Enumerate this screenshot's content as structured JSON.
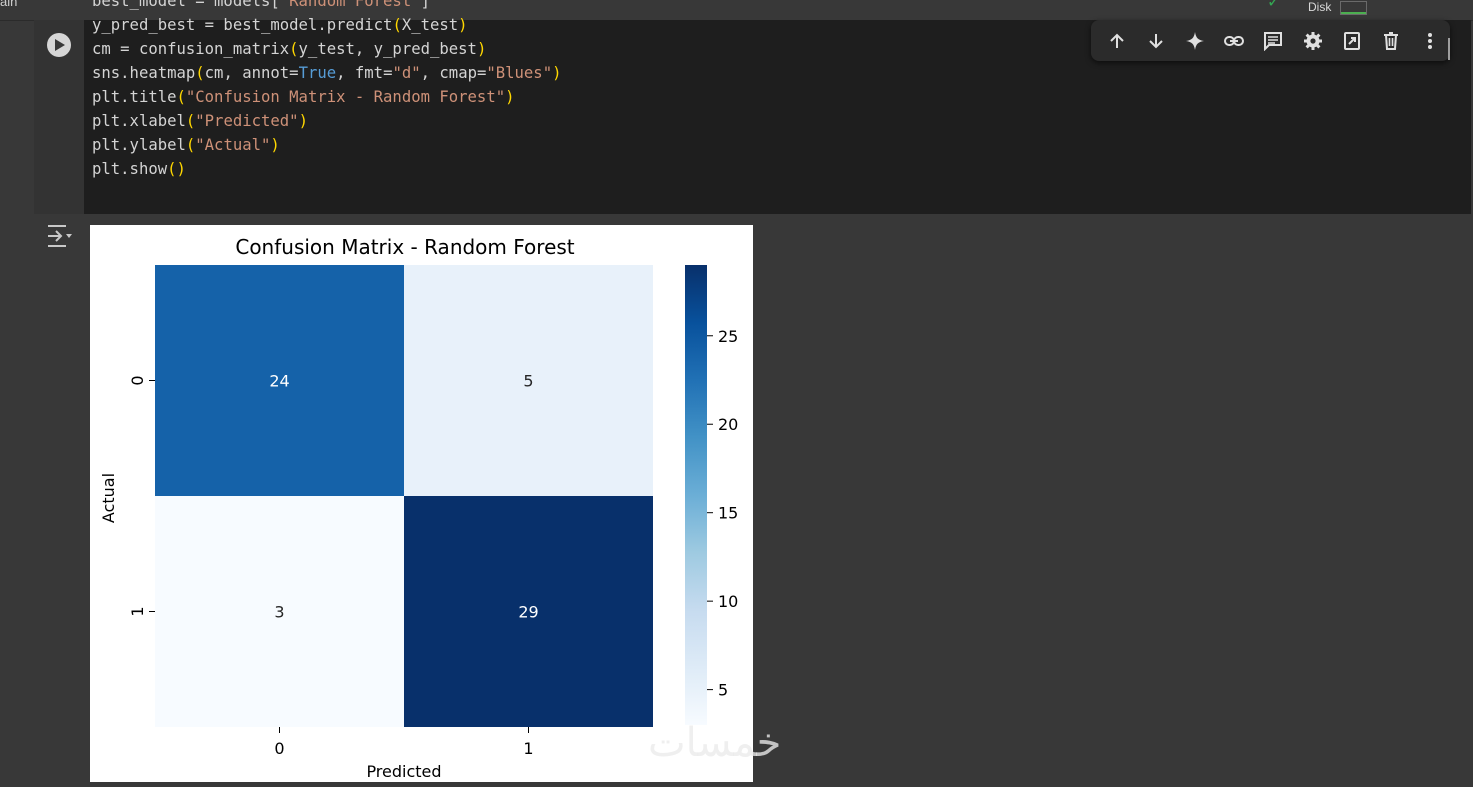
{
  "topbar": {
    "left_fragment": "ain",
    "disk_label": "Disk",
    "disk_fill_fraction": 0.1
  },
  "code": {
    "lines": [
      [
        {
          "t": "best_model = models["
        },
        {
          "t": "\"Random Forest\"",
          "c": "str"
        },
        {
          "t": "]"
        }
      ],
      [
        {
          "t": "y_pred_best = best_model.predict"
        },
        {
          "t": "(",
          "c": "par"
        },
        {
          "t": "X_test"
        },
        {
          "t": ")",
          "c": "par"
        }
      ],
      [
        {
          "t": "cm = confusion_matrix"
        },
        {
          "t": "(",
          "c": "par"
        },
        {
          "t": "y_test, y_pred_best"
        },
        {
          "t": ")",
          "c": "par"
        }
      ],
      [
        {
          "t": "sns.heatmap"
        },
        {
          "t": "(",
          "c": "par"
        },
        {
          "t": "cm, annot="
        },
        {
          "t": "True",
          "c": "kw"
        },
        {
          "t": ", fmt="
        },
        {
          "t": "\"d\"",
          "c": "str"
        },
        {
          "t": ", cmap="
        },
        {
          "t": "\"Blues\"",
          "c": "str"
        },
        {
          "t": ")",
          "c": "par"
        }
      ],
      [
        {
          "t": "plt.title"
        },
        {
          "t": "(",
          "c": "par"
        },
        {
          "t": "\"Confusion Matrix - Random Forest\"",
          "c": "str"
        },
        {
          "t": ")",
          "c": "par"
        }
      ],
      [
        {
          "t": "plt.xlabel"
        },
        {
          "t": "(",
          "c": "par"
        },
        {
          "t": "\"Predicted\"",
          "c": "str"
        },
        {
          "t": ")",
          "c": "par"
        }
      ],
      [
        {
          "t": "plt.ylabel"
        },
        {
          "t": "(",
          "c": "par"
        },
        {
          "t": "\"Actual\"",
          "c": "str"
        },
        {
          "t": ")",
          "c": "par"
        }
      ],
      [
        {
          "t": "plt.show"
        },
        {
          "t": "()",
          "c": "par"
        }
      ]
    ]
  },
  "toolbar": {
    "icons": [
      "arrow-up-icon",
      "arrow-down-icon",
      "sparkle-icon",
      "link-icon",
      "comment-icon",
      "gear-icon",
      "mirror-cell-icon",
      "trash-icon",
      "more-vert-icon"
    ]
  },
  "colors": {
    "string": "#ce9178",
    "keyword": "#569cd6",
    "paren": "#ffd700",
    "blues_low": "#f7fbff",
    "blues_high": "#08306b"
  },
  "chart_data": {
    "type": "heatmap",
    "title": "Confusion Matrix - Random Forest",
    "xlabel": "Predicted",
    "ylabel": "Actual",
    "x_categories": [
      "0",
      "1"
    ],
    "y_categories": [
      "0",
      "1"
    ],
    "values": [
      [
        24,
        5
      ],
      [
        3,
        29
      ]
    ],
    "colormap": "Blues",
    "colorbar": {
      "min": 3,
      "max": 29,
      "ticks": [
        5,
        10,
        15,
        20,
        25
      ]
    }
  },
  "watermark": "خمسات"
}
